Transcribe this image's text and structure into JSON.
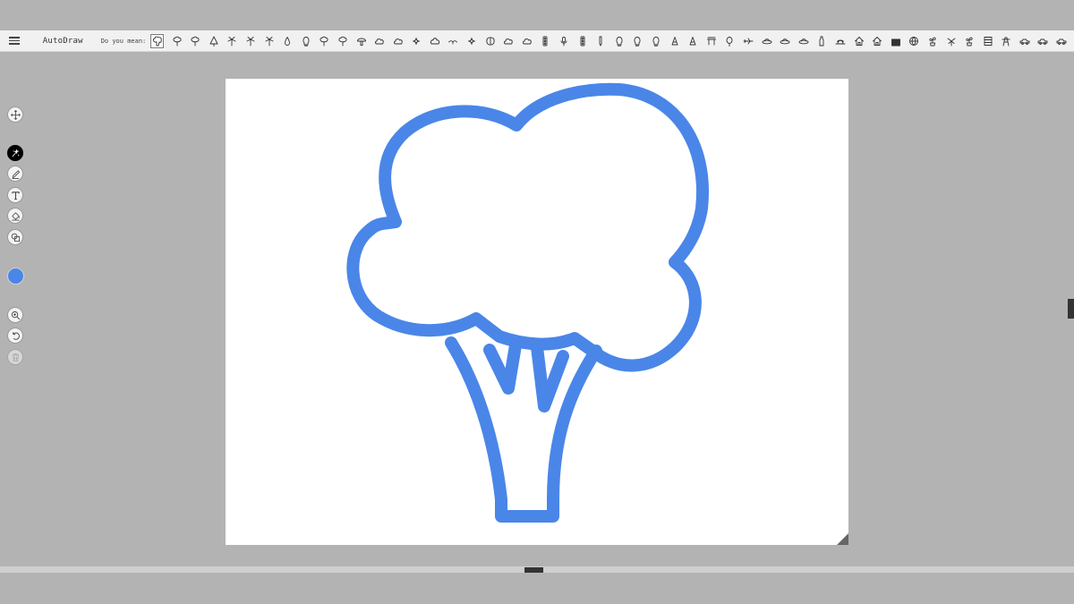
{
  "app": {
    "title": "AutoDraw"
  },
  "toolbar": {
    "suggest_label": "Do you mean:",
    "suggestion_icons": [
      "broccoli-icon",
      "tree-icon",
      "tree-icon",
      "pine-tree-icon",
      "palm-tree-icon",
      "palm-tree-icon",
      "palm-tree-icon",
      "raindrop-icon",
      "lightbulb-icon",
      "tree-icon",
      "tree-icon",
      "mushroom-icon",
      "cloud-icon",
      "cloud-icon",
      "flower-icon",
      "bush-icon",
      "bird-icon",
      "flower-icon",
      "brain-icon",
      "cloud-icon",
      "cloud-icon",
      "traffic-light-icon",
      "microphone-icon",
      "traffic-light-icon",
      "pencil-icon",
      "lightbulb-icon",
      "lightbulb-icon",
      "lightbulb-icon",
      "cone-icon",
      "cone-icon",
      "table-icon",
      "balloon-icon",
      "airplane-icon",
      "ufo-icon",
      "ufo-icon",
      "ufo-icon",
      "bottle-icon",
      "hat-icon",
      "house-icon",
      "house-icon",
      "building-icon",
      "globe-icon",
      "plant-icon",
      "windmill-icon",
      "plant-icon",
      "shelf-icon",
      "tower-icon",
      "car-icon",
      "car-icon",
      "car-icon",
      "car-icon"
    ]
  },
  "sidebar": {
    "tools": [
      {
        "name": "move-icon",
        "label": "Move"
      },
      {
        "name": "autodraw-icon",
        "label": "AutoDraw"
      },
      {
        "name": "pen-icon",
        "label": "Draw"
      },
      {
        "name": "text-icon",
        "label": "Type"
      },
      {
        "name": "fill-icon",
        "label": "Fill"
      },
      {
        "name": "shapes-icon",
        "label": "Shape"
      },
      {
        "name": "zoom-icon",
        "label": "Zoom"
      },
      {
        "name": "undo-icon",
        "label": "Undo"
      },
      {
        "name": "trash-icon",
        "label": "Delete"
      }
    ],
    "active_tool": "autodraw",
    "current_color": "#4a86e8"
  },
  "canvas": {
    "drawing": "broccoli-icon",
    "stroke_color": "#4a86e8",
    "background": "#ffffff"
  }
}
